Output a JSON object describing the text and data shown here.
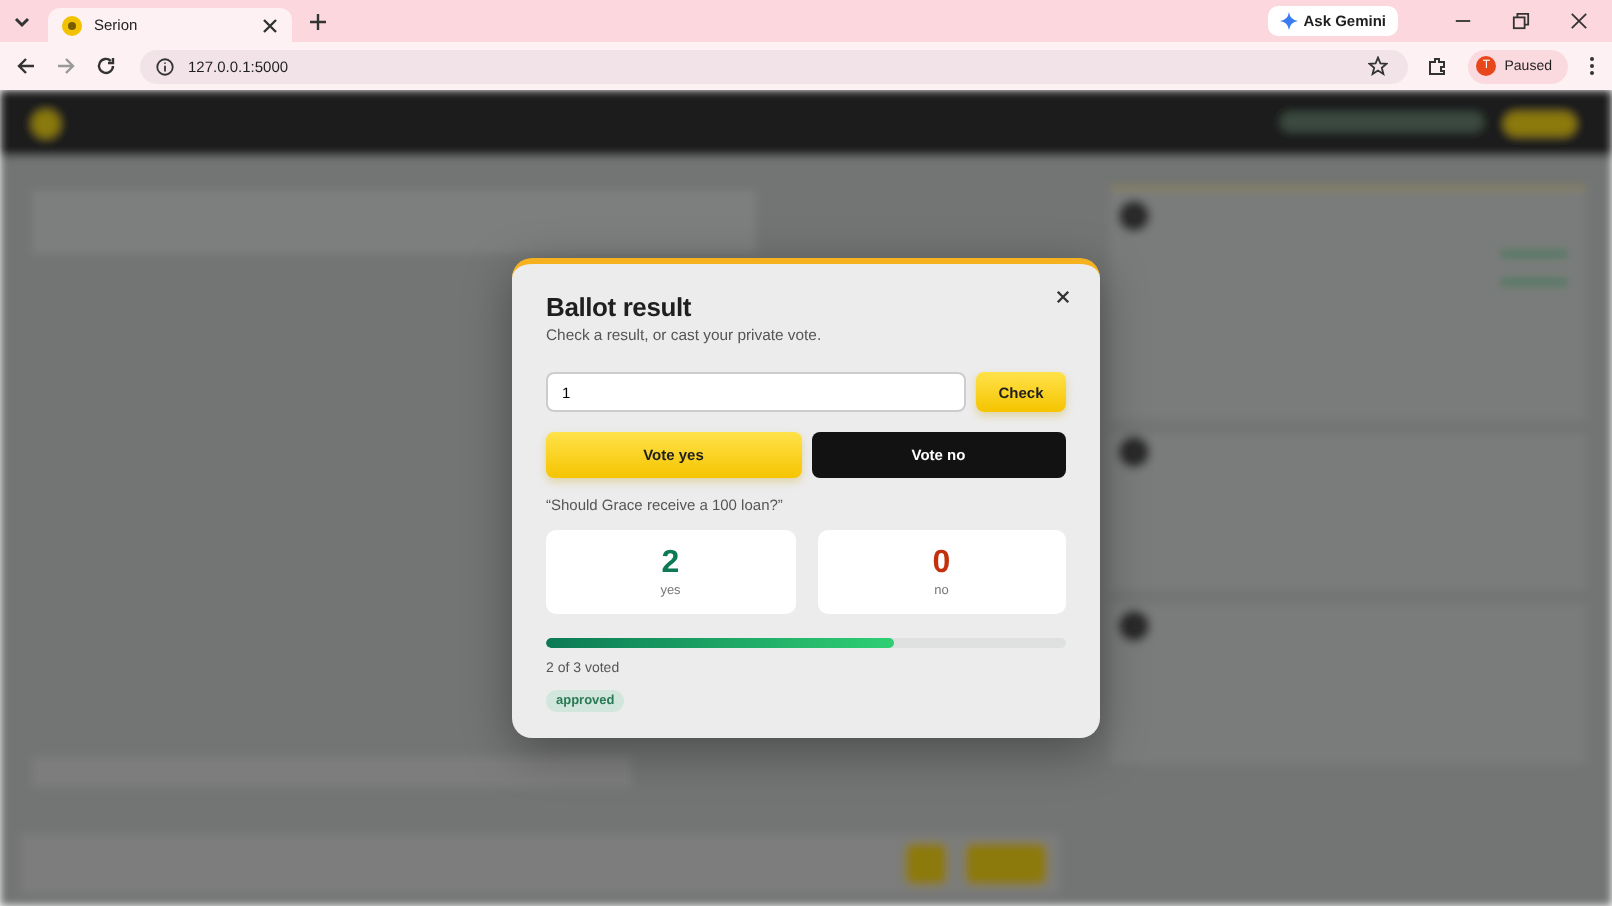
{
  "browser": {
    "tabs": [
      {
        "title": "Serion",
        "selected": true
      }
    ],
    "address": "127.0.0.1:5000",
    "gemini_button": "Ask Gemini",
    "profile": {
      "initial": "T",
      "status": "Paused"
    }
  },
  "dialog": {
    "title": "Ballot result",
    "subtitle": "Check a result, or cast your private vote.",
    "ballot_field": {
      "value": "1"
    },
    "check_button": "Check",
    "vote_buttons": [
      {
        "label": "Vote yes",
        "kind": "yes"
      },
      {
        "label": "Vote no",
        "kind": "no"
      }
    ],
    "question": "“Should Grace receive a 100 loan?”",
    "tallies": [
      {
        "count": "2",
        "label": "yes",
        "kind": "yes"
      },
      {
        "count": "0",
        "label": "no",
        "kind": "no"
      }
    ],
    "progress": {
      "level": 0.67
    },
    "turnout": "2 of 3 voted",
    "status_badge": "approved"
  }
}
